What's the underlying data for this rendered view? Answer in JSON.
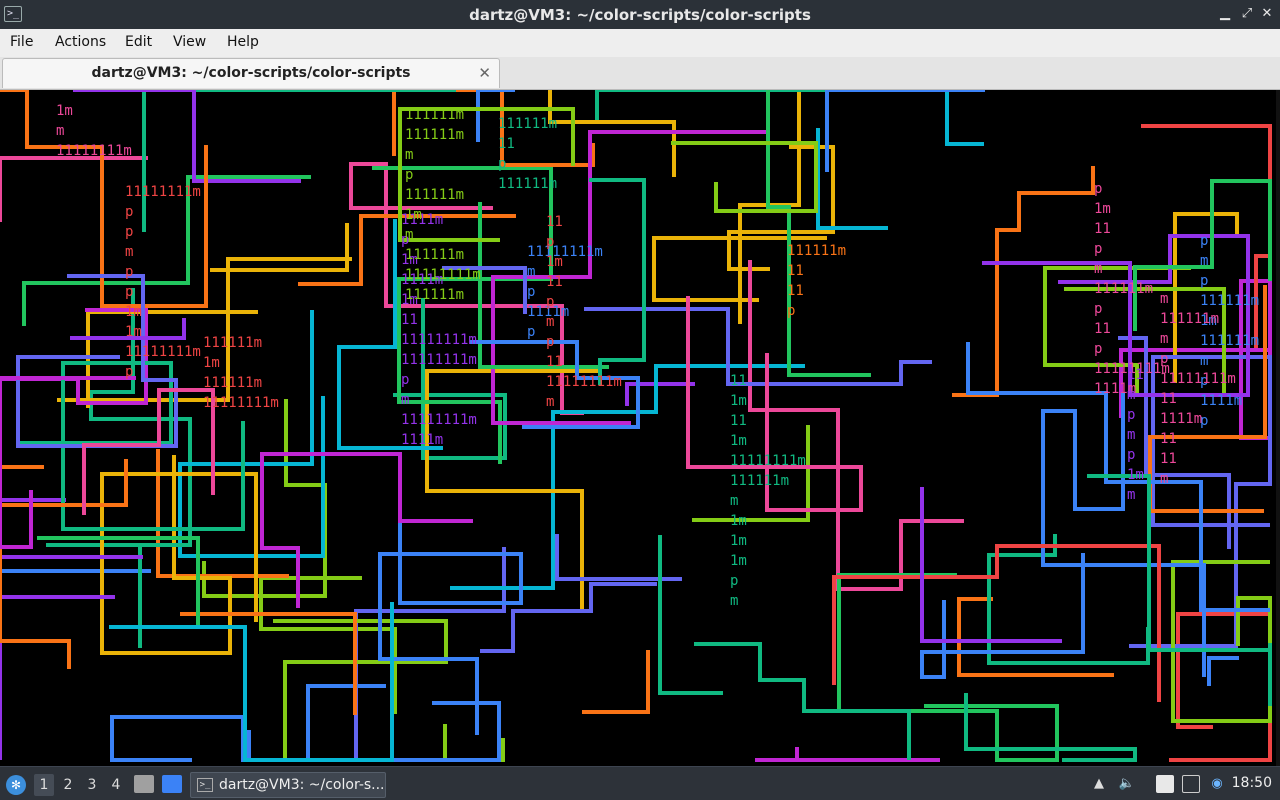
{
  "window": {
    "title": "dartz@VM3: ~/color-scripts/color-scripts",
    "icon": "terminal-icon",
    "controls": [
      "minimize-icon",
      "maximize-icon",
      "close-icon"
    ]
  },
  "menu": {
    "file": "File",
    "actions": "Actions",
    "edit": "Edit",
    "view": "View",
    "help": "Help"
  },
  "tab": {
    "label": "dartz@VM3: ~/color-scripts/color-scripts",
    "close": "✕"
  },
  "terminal": {
    "content": "color-scripts pipes animation output (colored line segments)",
    "glyphs": [
      "1m",
      "1111m",
      "111111m",
      "11111111m",
      "11",
      "p",
      "m"
    ],
    "palette": [
      "#22c55e",
      "#84cc16",
      "#eab308",
      "#f97316",
      "#ef4444",
      "#ec4899",
      "#c026d3",
      "#9333ea",
      "#6366f1",
      "#3b82f6",
      "#06b6d4",
      "#10b981"
    ]
  },
  "taskbar": {
    "workspaces": [
      "1",
      "2",
      "3",
      "4"
    ],
    "active_workspace": "1",
    "task_label": "dartz@VM3: ~/color-s...",
    "clock": "18:50"
  }
}
